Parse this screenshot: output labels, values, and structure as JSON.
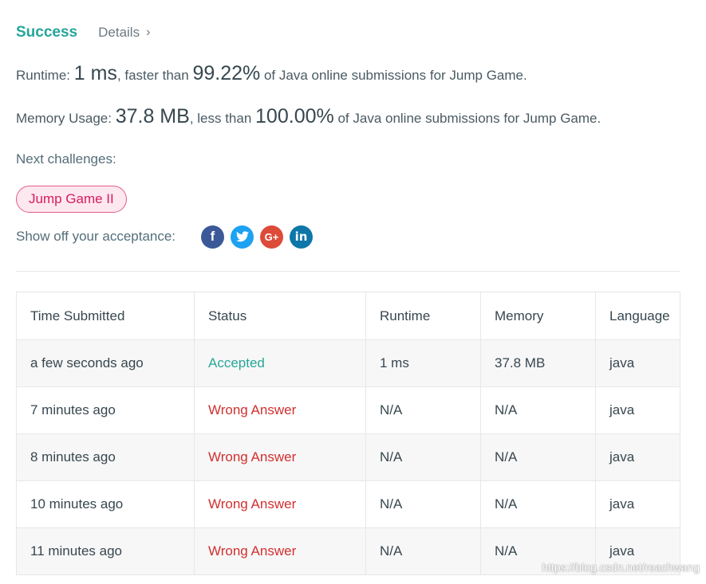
{
  "header": {
    "status": "Success",
    "details_label": "Details",
    "chevron": "›"
  },
  "runtime_line": {
    "prefix": "Runtime: ",
    "value": "1 ms",
    "mid": ", faster than ",
    "percent": "99.22%",
    "suffix": " of Java online submissions for Jump Game."
  },
  "memory_line": {
    "prefix": "Memory Usage: ",
    "value": "37.8 MB",
    "mid": ", less than ",
    "percent": "100.00%",
    "suffix": " of Java online submissions for Jump Game."
  },
  "next": {
    "label": "Next challenges:",
    "challenge": "Jump Game II"
  },
  "share": {
    "label": "Show off your acceptance:",
    "icons": {
      "facebook": "f",
      "twitter": "twitter-icon",
      "google_plus": "G+",
      "linkedin": "in"
    }
  },
  "table": {
    "headers": [
      "Time Submitted",
      "Status",
      "Runtime",
      "Memory",
      "Language"
    ],
    "rows": [
      {
        "time": "a few seconds ago",
        "status": "Accepted",
        "runtime": "1 ms",
        "memory": "37.8 MB",
        "language": "java"
      },
      {
        "time": "7 minutes ago",
        "status": "Wrong Answer",
        "runtime": "N/A",
        "memory": "N/A",
        "language": "java"
      },
      {
        "time": "8 minutes ago",
        "status": "Wrong Answer",
        "runtime": "N/A",
        "memory": "N/A",
        "language": "java"
      },
      {
        "time": "10 minutes ago",
        "status": "Wrong Answer",
        "runtime": "N/A",
        "memory": "N/A",
        "language": "java"
      },
      {
        "time": "11 minutes ago",
        "status": "Wrong Answer",
        "runtime": "N/A",
        "memory": "N/A",
        "language": "java"
      }
    ]
  },
  "watermark": "https://blog.csdn.net/reachwang",
  "colors": {
    "accent": "#26a69a",
    "wrong": "#d32f2f",
    "pill_border": "#e45c8c",
    "pill_bg": "#fde8ef"
  }
}
